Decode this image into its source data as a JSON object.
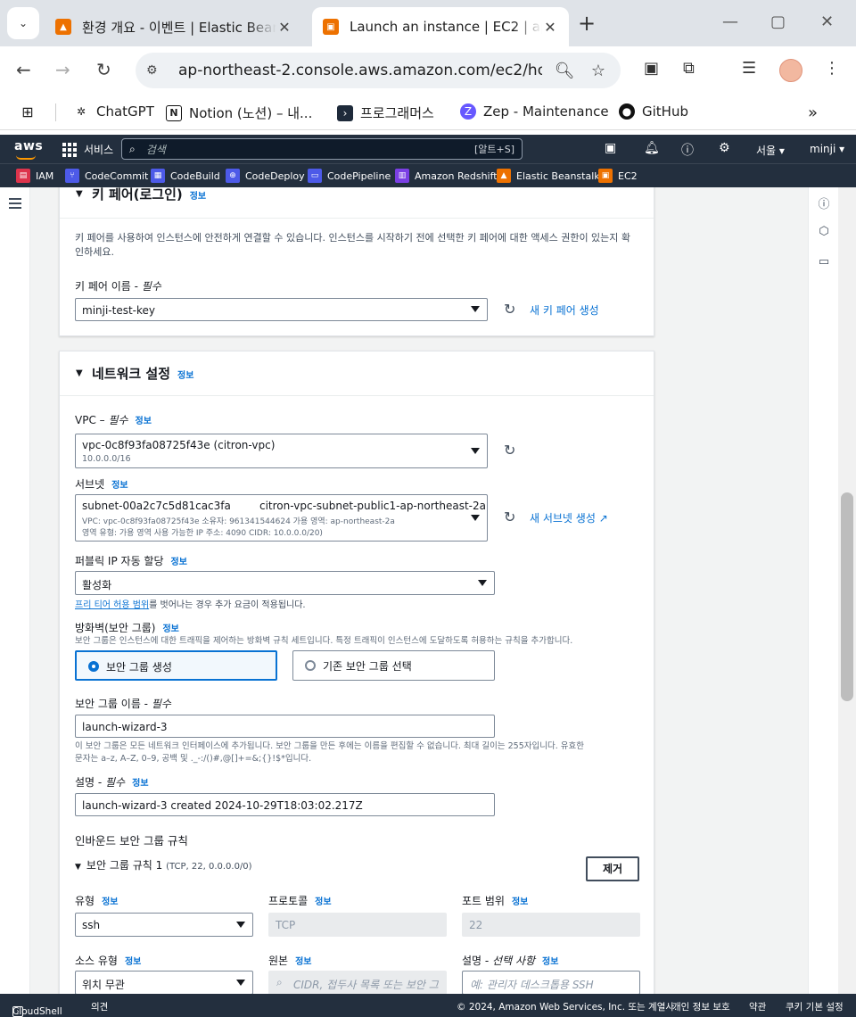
{
  "browser": {
    "tabs": [
      {
        "title": "환경 개요 - 이벤트 | Elastic Beanstalk"
      },
      {
        "title": "Launch an instance | EC2 | ap-northeast-2"
      }
    ],
    "url": "ap-northeast-2.console.aws.amazon.com/ec2/ho...",
    "bookmarks": [
      "ChatGPT",
      "Notion (노션) – 내...",
      "프로그래머스",
      "Zep - Maintenance",
      "GitHub"
    ]
  },
  "aws": {
    "logo": "aws",
    "services_label": "서비스",
    "search_placeholder": "검색",
    "search_shortcut": "[알트+S]",
    "region": "서울",
    "user": "minji",
    "favorites": [
      "IAM",
      "CodeCommit",
      "CodeBuild",
      "CodeDeploy",
      "CodePipeline",
      "Amazon Redshift",
      "Elastic Beanstalk",
      "EC2"
    ]
  },
  "keypair": {
    "heading": "키 페어(로그인)",
    "info": "정보",
    "description": "키 페어를 사용하여 인스턴스에 안전하게 연결할 수 있습니다. 인스턴스를 시작하기 전에 선택한 키 페어에 대한 액세스 권한이 있는지 확인하세요.",
    "name_label": "키 페어 이름 - ",
    "required": "필수",
    "value": "minji-test-key",
    "create_link": "새 키 페어 생성"
  },
  "network": {
    "heading": "네트워크 설정",
    "info": "정보",
    "vpc_label": "VPC – ",
    "required": "필수",
    "vpc_value": "vpc-0c8f93fa08725f43e (citron-vpc)",
    "vpc_cidr": "10.0.0.0/16",
    "subnet_label": "서브넷",
    "subnet_id": "subnet-00a2c7c5d81cac3fa",
    "subnet_name": "citron-vpc-subnet-public1-ap-northeast-2a",
    "subnet_meta1": "VPC: vpc-0c8f93fa08725f43e     소유자: 961341544624     가용 영역: ap-northeast-2a",
    "subnet_meta2": "영역 유형: 가용 영역     사용 가능한 IP 주소: 4090     CIDR: 10.0.0.0/20)",
    "create_subnet_link": "새 서브넷 생성",
    "public_ip_label": "퍼블릭 IP 자동 할당",
    "public_ip_value": "활성화",
    "free_tier_link": "프리 티어 허용 범위",
    "free_tier_note": "를 벗어나는 경우 추가 요금이 적용됩니다.",
    "firewall_label": "방화벽(보안 그룹)",
    "firewall_desc": "보안 그룹은 인스턴스에 대한 트래픽을 제어하는 방화벽 규칙 세트입니다. 특정 트래픽이 인스턴스에 도달하도록 허용하는 규칙을 추가합니다.",
    "sg_create": "보안 그룹 생성",
    "sg_existing": "기존 보안 그룹 선택",
    "sg_name_label": "보안 그룹 이름 - ",
    "sg_name_value": "launch-wizard-3",
    "sg_name_help1": "이 보안 그룹은 모든 네트워크 인터페이스에 추가됩니다. 보안 그룹을 만든 후에는 이름을 편집할 수 없습니다. 최대 길이는 255자입니다. 유효한",
    "sg_name_help2": "문자는 a–z, A–Z, 0–9, 공백 및 ._-:/()#,@[]+=&;{}!$*입니다.",
    "desc_label": "설명 - ",
    "desc_value": "launch-wizard-3 created 2024-10-29T18:03:02.217Z",
    "inbound_heading": "인바운드 보안 그룹 규칙",
    "rule_title": "보안 그룹 규칙 1",
    "rule_summary": "(TCP, 22, 0.0.0.0/0)",
    "remove_button": "제거",
    "type_label": "유형",
    "type_value": "ssh",
    "protocol_label": "프로토콜",
    "protocol_value": "TCP",
    "port_label": "포트 범위",
    "port_value": "22",
    "source_type_label": "소스 유형",
    "source_type_value": "위치 무관",
    "source_label": "원본",
    "source_placeholder": "CIDR, 접두사 목록 또는 보안 그",
    "rule_desc_label": "설명 - ",
    "optional": "선택 사항",
    "rule_desc_placeholder": "예: 관리자 데스크톱용 SSH"
  },
  "footer": {
    "cloudshell": "CloudShell",
    "feedback": "의견",
    "copyright": "© 2024, Amazon Web Services, Inc. 또는 계열사.",
    "privacy": "개인 정보 보호",
    "terms": "약관",
    "cookies": "쿠키 기본 설정"
  }
}
